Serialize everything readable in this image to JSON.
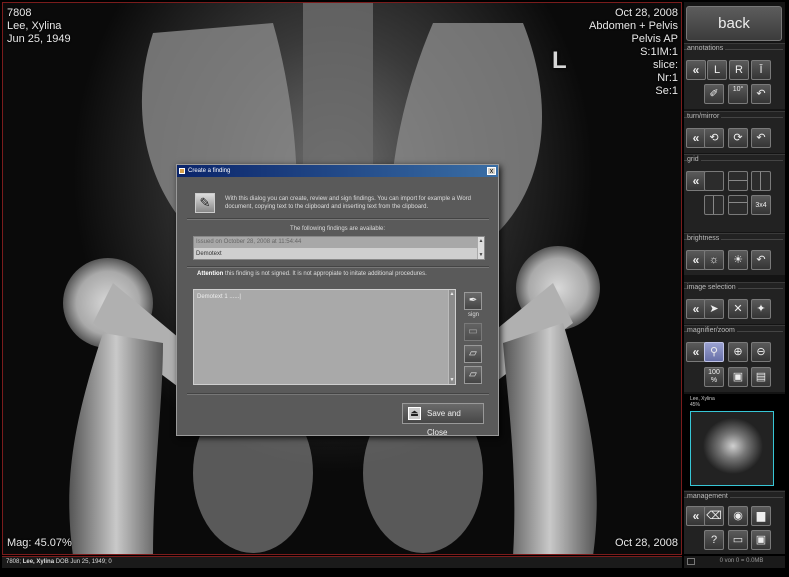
{
  "overlay": {
    "top_left": [
      "7808",
      "Lee, Xylina",
      "Jun 25, 1949"
    ],
    "top_right": [
      "Oct 28, 2008",
      "Abdomen + Pelvis",
      "Pelvis AP",
      "S:1IM:1",
      "slice:",
      "Nr:1",
      "Se:1"
    ],
    "bottom_left": "Mag: 45.07%",
    "bottom_right": "Oct 28, 2008",
    "orientation_marker": "L"
  },
  "statusbar": {
    "id": "7808;",
    "name": "Lee, Xylina",
    "rest": "DOB Jun 25, 1949; 0",
    "right": "0 von 0 = 0.0MB"
  },
  "panel": {
    "back_label": "back",
    "sections": {
      "annotations": "annotations",
      "turn_mirror": "turn/mirror",
      "grid": "grid",
      "brightness": "brightness",
      "image_selection": "image selection",
      "magnifier_zoom": "magnifier/zoom",
      "management": "management"
    },
    "buttons": {
      "collapse": "«",
      "annot_left": "L",
      "annot_right": "R",
      "annot_text": "Ī",
      "annot_draw": "✐",
      "annot_angle": "10°",
      "undo": "↶",
      "rotate_ccw": "⟲",
      "rotate_cw": "⟳",
      "grid_3x4": "3x4",
      "bright_down": "☼",
      "bright_up": "☀",
      "select_arrow": "➤",
      "select_cross": "✕",
      "select_pin": "✦",
      "zoom_magnifier": "⚲",
      "zoom_in": "⊕",
      "zoom_out": "⊖",
      "zoom_100_line1": "100",
      "zoom_100_line2": "%",
      "fit_screen": "▣",
      "fit_window": "▤",
      "mgmt_eraser": "⌫",
      "mgmt_cd": "◉",
      "mgmt_save": "▆",
      "mgmt_help": "?",
      "mgmt_monitor": "▭",
      "mgmt_export": "▣"
    },
    "thumbnail": {
      "label_line1": "Lee, Xylina",
      "label_line2": "45%"
    }
  },
  "dialog": {
    "title": "Create a finding",
    "close_label": "x",
    "intro": "With this dialog you can create, review and sign findings. You can import for example a Word document, copying text to the clipboard and inserting text from the clipboard.",
    "list_heading": "The following findings are available:",
    "findings": [
      "Issued on October 28, 2008 at 11:54:44",
      "Demotext"
    ],
    "attention_bold": "Attention",
    "attention_text": "this finding is not signed. It is not appropiate to initate additional procedures.",
    "text_value": "Demotext 1 ......|",
    "sign_label": "sign",
    "save_close_label": "Save and Close"
  }
}
